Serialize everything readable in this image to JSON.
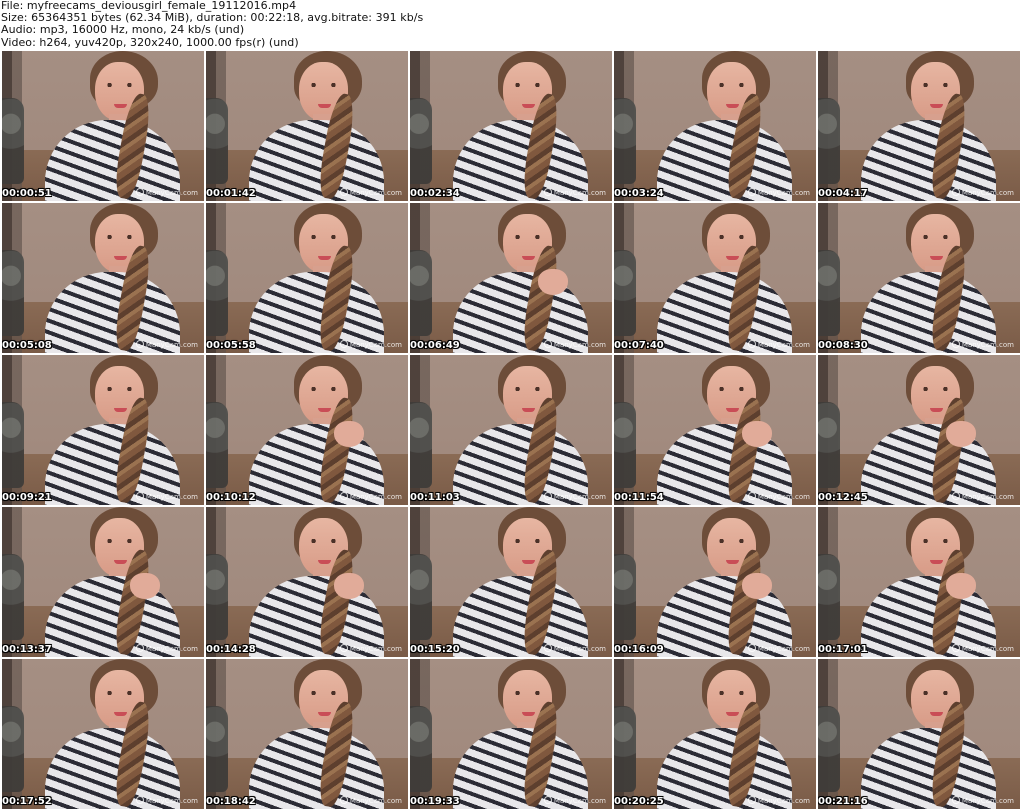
{
  "header": {
    "file_line": "File: myfreecams_deviousgirl_female_19112016.mp4",
    "size_line": "Size: 65364351 bytes (62.34 MiB), duration: 00:22:18, avg.bitrate: 391 kb/s",
    "audio_line": "Audio: mp3, 16000 Hz, mono, 24 kb/s (und)",
    "video_line": "Video: h264, yuv420p, 320x240, 1000.00 fps(r) (und)"
  },
  "watermark": "ManyCam.com",
  "thumbnails": [
    {
      "time": "00:00:51",
      "hand": false
    },
    {
      "time": "00:01:42",
      "hand": false
    },
    {
      "time": "00:02:34",
      "hand": false
    },
    {
      "time": "00:03:24",
      "hand": false
    },
    {
      "time": "00:04:17",
      "hand": false
    },
    {
      "time": "00:05:08",
      "hand": false
    },
    {
      "time": "00:05:58",
      "hand": false
    },
    {
      "time": "00:06:49",
      "hand": true
    },
    {
      "time": "00:07:40",
      "hand": false
    },
    {
      "time": "00:08:30",
      "hand": false
    },
    {
      "time": "00:09:21",
      "hand": false
    },
    {
      "time": "00:10:12",
      "hand": true
    },
    {
      "time": "00:11:03",
      "hand": false
    },
    {
      "time": "00:11:54",
      "hand": true
    },
    {
      "time": "00:12:45",
      "hand": true
    },
    {
      "time": "00:13:37",
      "hand": true
    },
    {
      "time": "00:14:28",
      "hand": true
    },
    {
      "time": "00:15:20",
      "hand": false
    },
    {
      "time": "00:16:09",
      "hand": true
    },
    {
      "time": "00:17:01",
      "hand": true
    },
    {
      "time": "00:17:52",
      "hand": false
    },
    {
      "time": "00:18:42",
      "hand": false
    },
    {
      "time": "00:19:33",
      "hand": false
    },
    {
      "time": "00:20:25",
      "hand": false
    },
    {
      "time": "00:21:16",
      "hand": false
    }
  ]
}
